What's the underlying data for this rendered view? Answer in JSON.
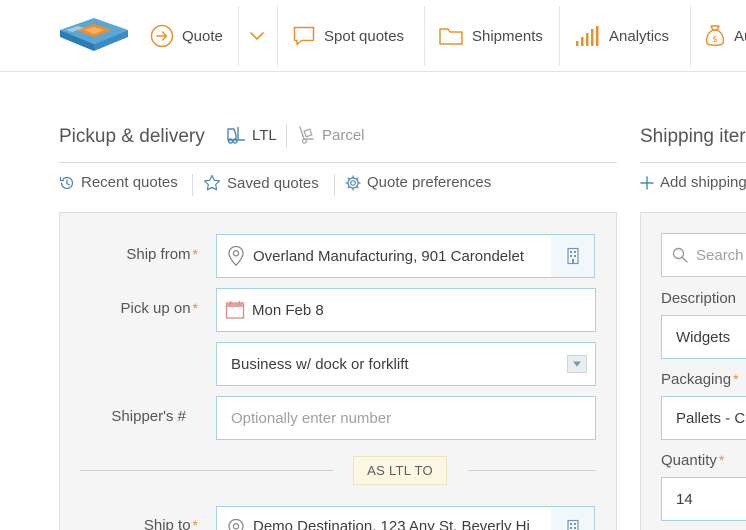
{
  "nav": {
    "items": [
      {
        "label": "Quote",
        "icon": "arrow-circle-right-icon"
      },
      {
        "label": "Spot quotes",
        "icon": "chat-bubble-icon"
      },
      {
        "label": "Shipments",
        "icon": "folder-icon"
      },
      {
        "label": "Analytics",
        "icon": "bar-chart-icon"
      },
      {
        "label": "Au",
        "icon": "money-bag-icon"
      }
    ]
  },
  "pickup": {
    "title": "Pickup & delivery",
    "modes": [
      {
        "label": "LTL",
        "icon": "forklift-icon",
        "active": true
      },
      {
        "label": "Parcel",
        "icon": "hand-truck-icon",
        "active": false
      }
    ],
    "tools": [
      {
        "label": "Recent quotes",
        "icon": "history-icon"
      },
      {
        "label": "Saved quotes",
        "icon": "star-icon"
      },
      {
        "label": "Quote preferences",
        "icon": "gear-icon"
      }
    ],
    "ship_from": {
      "label": "Ship from",
      "value": "Overland Manufacturing, 901 Carondelet"
    },
    "pick_up_on": {
      "label": "Pick up on",
      "value": "Mon Feb 8"
    },
    "location_type": {
      "value": "Business w/ dock or forklift"
    },
    "shipper_number": {
      "label": "Shipper's #",
      "placeholder": "Optionally enter number"
    },
    "divider_badge": "AS LTL TO",
    "ship_to": {
      "label": "Ship to",
      "value": "Demo Destination, 123 Any St, Beverly Hi"
    },
    "required_mark": "*"
  },
  "shipping_items": {
    "title": "Shipping iter",
    "add_label": "Add shipping",
    "search_placeholder": "Search",
    "description": {
      "label": "Description",
      "value": "Widgets"
    },
    "packaging": {
      "label": "Packaging",
      "value": "Pallets - C"
    },
    "quantity": {
      "label": "Quantity",
      "value": "14"
    }
  },
  "colors": {
    "accent_orange": "#e8902a",
    "field_border": "#a9d2e0",
    "panel_bg": "#f5f5f5"
  }
}
